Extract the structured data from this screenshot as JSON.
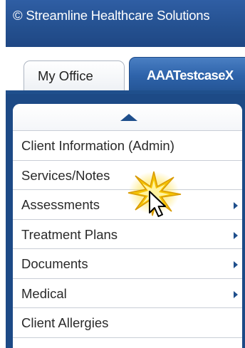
{
  "header": {
    "title": "© Streamline Healthcare Solutions"
  },
  "tabs": [
    {
      "label": "My Office",
      "active": false
    },
    {
      "label": "AAATestcaseX",
      "active": true
    }
  ],
  "menu": {
    "scroll_up_icon": "up-arrow-icon",
    "items": [
      {
        "label": "Client Information (Admin)",
        "has_submenu": false
      },
      {
        "label": "Services/Notes",
        "has_submenu": false
      },
      {
        "label": "Assessments",
        "has_submenu": true
      },
      {
        "label": "Treatment Plans",
        "has_submenu": true
      },
      {
        "label": "Documents",
        "has_submenu": true
      },
      {
        "label": "Medical",
        "has_submenu": true
      },
      {
        "label": "Client Allergies",
        "has_submenu": false
      }
    ]
  },
  "colors": {
    "header_blue": "#24508f",
    "panel_blue": "#1d4a86",
    "active_tab_blue": "#2e63aa",
    "click_burst": "#f5c400"
  }
}
